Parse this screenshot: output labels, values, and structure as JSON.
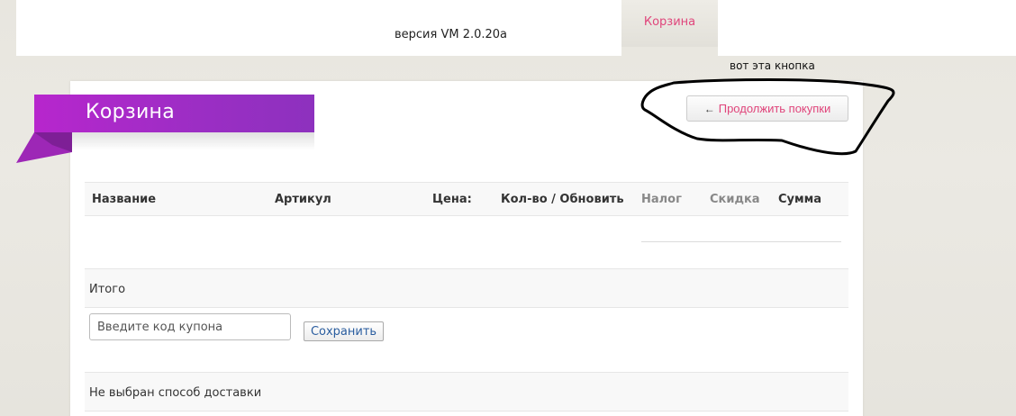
{
  "header": {
    "version": "версия VM 2.0.20a",
    "active_tab": "Корзина"
  },
  "annotation": {
    "note": "вот эта кнопка"
  },
  "cart": {
    "title": "Корзина",
    "continue_arrow": "🡐",
    "continue_label": "Продолжить покупки",
    "columns": [
      "Название",
      "Артикул",
      "Цена:",
      "Кол-во / Обновить",
      "Налог",
      "Скидка",
      "Сумма"
    ],
    "total_label": "Итого",
    "coupon_placeholder": "Введите код купона",
    "coupon_value": "",
    "save_label": "Сохранить",
    "shipping_label": "Не выбран способ доставки"
  },
  "colors": {
    "accent_pink": "#e0457b",
    "ribbon_purple": "#a82bc8",
    "link_blue": "#2a5d9f"
  }
}
